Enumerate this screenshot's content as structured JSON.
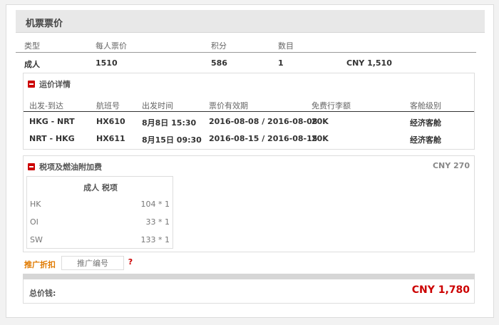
{
  "panel": {
    "title": "机票票价"
  },
  "summary": {
    "headers": [
      "类型",
      "每人票价",
      "积分",
      "数目"
    ],
    "row": {
      "type": "成人",
      "price": "1510",
      "points": "586",
      "count": "1",
      "subtotal": "CNY 1,510"
    }
  },
  "fare_details": {
    "title": "运价详情",
    "headers": [
      "出发-到达",
      "航班号",
      "出发时间",
      "票价有效期",
      "免费行李额",
      "客舱级别"
    ],
    "rows": [
      {
        "route": "HKG - NRT",
        "flight": "HX610",
        "time": "8月8日 15:30",
        "validity": "2016-08-08 / 2016-08-08",
        "baggage": "20K",
        "cabin": "经济客舱"
      },
      {
        "route": "NRT - HKG",
        "flight": "HX611",
        "time": "8月15日 09:30",
        "validity": "2016-08-15 / 2016-08-15",
        "baggage": "20K",
        "cabin": "经济客舱"
      }
    ]
  },
  "taxes": {
    "title": "税项及燃油附加费",
    "total": "CNY 270",
    "table_title": "成人 税项",
    "items": [
      {
        "code": "HK",
        "amount": "104 * 1"
      },
      {
        "code": "OI",
        "amount": "33 * 1"
      },
      {
        "code": "SW",
        "amount": "133 * 1"
      }
    ]
  },
  "promo": {
    "label": "推广折扣",
    "placeholder": "推广编号",
    "help": "?"
  },
  "total": {
    "label": "总价钱:",
    "value": "CNY 1,780"
  },
  "colors": {
    "accent_red": "#cc0000",
    "promo_orange": "#e07a00",
    "header_gray": "#e8e8e8"
  }
}
